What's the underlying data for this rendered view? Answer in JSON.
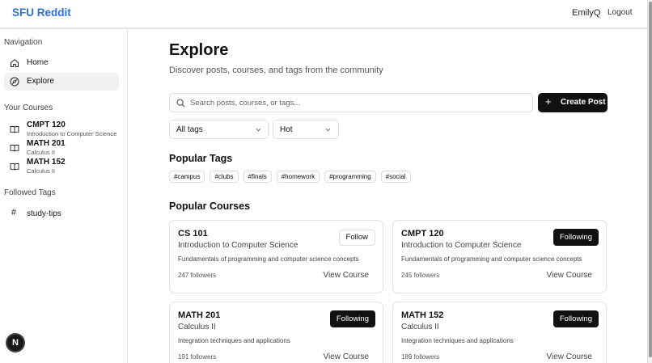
{
  "header": {
    "brand": "SFU Reddit",
    "username": "EmilyQ",
    "logout_label": "Logout"
  },
  "sidebar": {
    "navigation_title": "Navigation",
    "nav_items": [
      {
        "label": "Home",
        "icon": "home-icon",
        "active": false
      },
      {
        "label": "Explore",
        "icon": "compass-icon",
        "active": true
      }
    ],
    "courses_title": "Your Courses",
    "courses": [
      {
        "code": "CMPT 120",
        "name": "Introduction to Computer Science",
        "icon": "book-icon"
      },
      {
        "code": "MATH 201",
        "name": "Calculus II",
        "icon": "book-icon"
      },
      {
        "code": "MATH 152",
        "name": "Calculus II",
        "icon": "book-icon"
      }
    ],
    "tags_title": "Followed Tags",
    "tags": [
      {
        "label": "study-tips",
        "icon": "hash-icon"
      }
    ]
  },
  "fab": {
    "label": "N"
  },
  "main": {
    "title": "Explore",
    "subtitle": "Discover posts, courses, and tags from the community",
    "search": {
      "placeholder": "Search posts, courses, or tags...",
      "value": ""
    },
    "create_post_label": "Create Post",
    "filters": {
      "tags_value": "All tags",
      "sort_value": "Hot"
    },
    "popular_tags_title": "Popular Tags",
    "popular_tags": [
      "#campus",
      "#clubs",
      "#finals",
      "#homework",
      "#programming",
      "#social"
    ],
    "popular_courses_title": "Popular Courses",
    "courses": [
      {
        "code": "CS 101",
        "name": "Introduction to Computer Science",
        "description": "Fundamentals of programming and computer science concepts",
        "followers": "247 followers",
        "follow_label": "Follow",
        "following": false,
        "view_label": "View Course"
      },
      {
        "code": "CMPT 120",
        "name": "Introduction to Computer Science",
        "description": "Fundamentals of programming and computer science concepts",
        "followers": "245 followers",
        "follow_label": "Following",
        "following": true,
        "view_label": "View Course"
      },
      {
        "code": "MATH 201",
        "name": "Calculus II",
        "description": "Integration techniques and applications",
        "followers": "191 followers",
        "follow_label": "Following",
        "following": true,
        "view_label": "View Course"
      },
      {
        "code": "MATH 152",
        "name": "Calculus II",
        "description": "Integration techniques and applications",
        "followers": "189 followers",
        "follow_label": "Following",
        "following": true,
        "view_label": "View Course"
      }
    ]
  },
  "colors": {
    "brand": "#2f6fd6",
    "primary_button": "#111111",
    "active_nav_bg": "#f1f1f1",
    "border": "#e2e2e2"
  }
}
